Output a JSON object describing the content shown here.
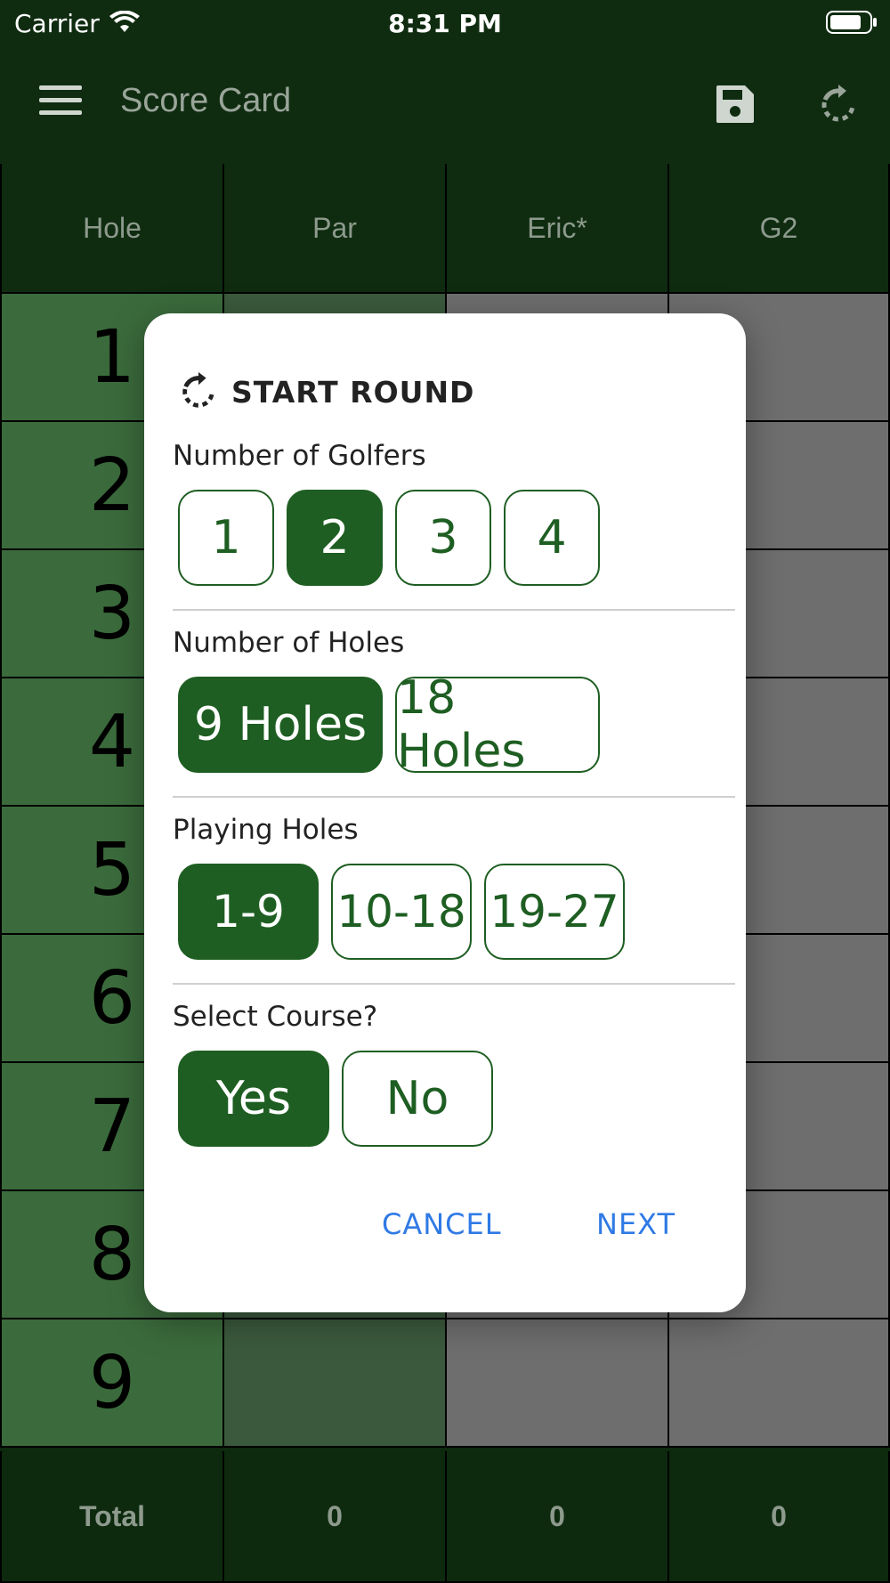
{
  "status_bar": {
    "carrier": "Carrier",
    "time": "8:31 PM"
  },
  "app_bar": {
    "title": "Score Card",
    "icons": [
      "menu-icon",
      "save-icon",
      "refresh-icon"
    ]
  },
  "table": {
    "headers": [
      "Hole",
      "Par",
      "Eric*",
      "G2"
    ],
    "holes": [
      "1",
      "2",
      "3",
      "4",
      "5",
      "6",
      "7",
      "8",
      "9"
    ],
    "total": {
      "label": "Total",
      "par": "0",
      "player1": "0",
      "player2": "0"
    }
  },
  "dialog": {
    "title": "START ROUND",
    "golfers": {
      "label": "Number of Golfers",
      "options": [
        "1",
        "2",
        "3",
        "4"
      ],
      "selected": "2"
    },
    "holes": {
      "label": "Number of Holes",
      "options": [
        "9 Holes",
        "18 Holes"
      ],
      "selected": "9 Holes"
    },
    "playing": {
      "label": "Playing Holes",
      "options": [
        "1-9",
        "10-18",
        "19-27"
      ],
      "selected": "1-9"
    },
    "course": {
      "label": "Select Course?",
      "options": [
        "Yes",
        "No"
      ],
      "selected": "Yes"
    },
    "cancel_label": "CANCEL",
    "next_label": "NEXT"
  },
  "colors": {
    "app_bar": "#0f2c10",
    "hole_column": "#3b6b3c",
    "option_green": "#1e5e22",
    "action_blue": "#2f7ae5"
  }
}
